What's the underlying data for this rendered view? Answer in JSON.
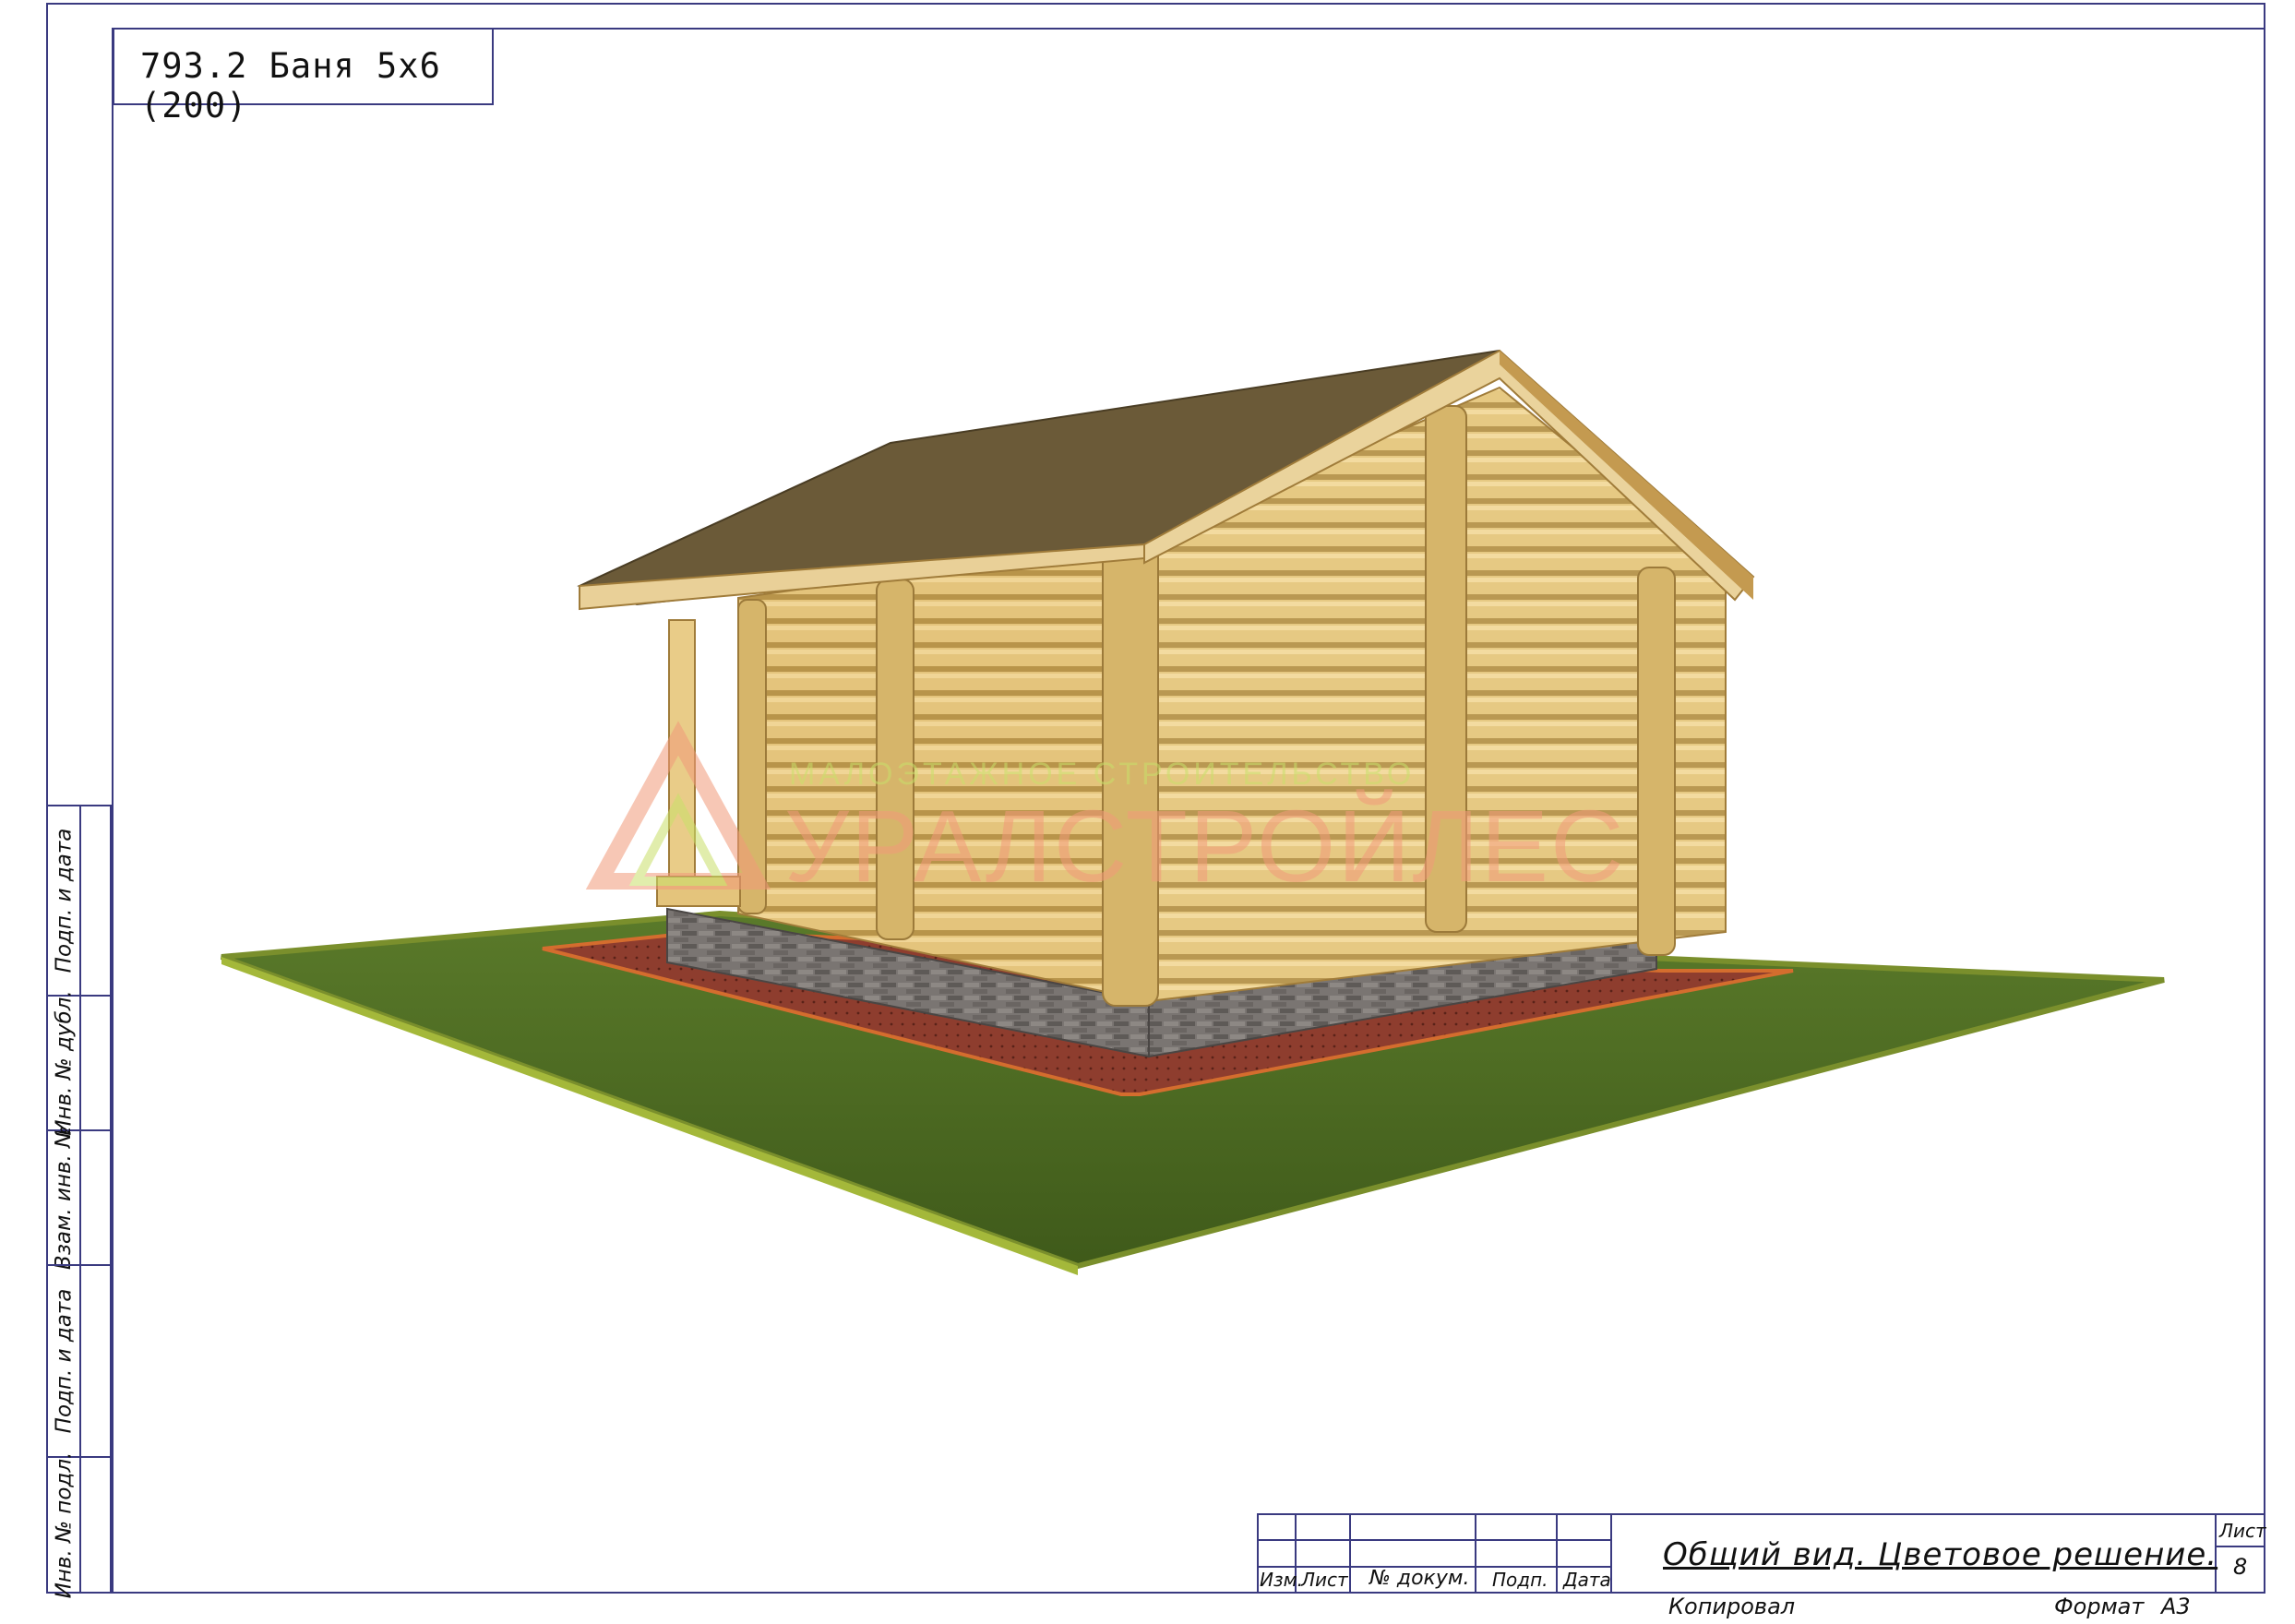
{
  "sheet": {
    "title": "793.2 Баня 5х6 (200)"
  },
  "watermark": {
    "brand": "УРАЛСТРОЙЛЕС",
    "tagline": "МАЛОЭТАЖНОЕ СТРОИТЕЛЬСТВО"
  },
  "side_strip": {
    "labels": [
      "Подп. и дата",
      "Инв. № дубл.",
      "Взам. инв. №",
      "Подп. и дата",
      "Инв. № подл."
    ]
  },
  "stamp": {
    "headers": [
      "Изм.",
      "Лист",
      "№ докум.",
      "Подп.",
      "Дата"
    ],
    "title": "Общий вид. Цветовое решение.",
    "sheet_label": "Лист",
    "sheet_number": "8",
    "copied": "Копировал",
    "format_label": "Формат",
    "format_value": "А3"
  },
  "colors": {
    "frame": "#3a3a80",
    "log_wall": "#e2c279",
    "roof": "#6b5a38",
    "grass": "#4e6a22",
    "paving": "#8a3a2c",
    "brick_plinth": "#6f6b68"
  }
}
